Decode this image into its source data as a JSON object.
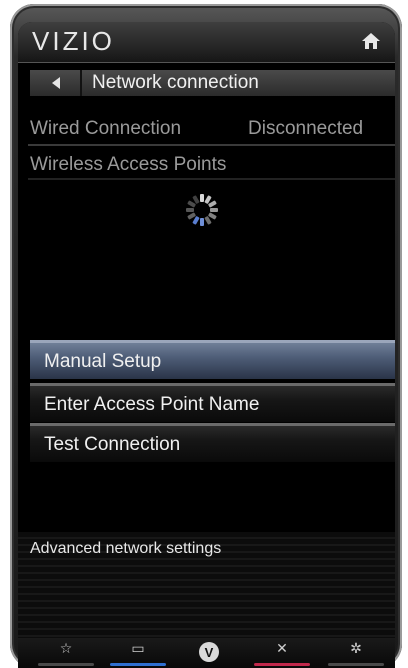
{
  "brand": "VIZIO",
  "header": {
    "title": "Network connection"
  },
  "wired": {
    "label": "Wired Connection",
    "status": "Disconnected"
  },
  "wireless": {
    "label": "Wireless Access Points"
  },
  "menu": {
    "items": [
      {
        "label": "Manual Setup",
        "selected": true
      },
      {
        "label": "Enter Access Point Name",
        "selected": false
      },
      {
        "label": "Test Connection",
        "selected": false
      }
    ]
  },
  "advanced": {
    "label": "Advanced network settings"
  },
  "bottom": {
    "buttons": [
      {
        "icon": "star-icon",
        "glyph": "☆",
        "color": "#4a4a4a"
      },
      {
        "icon": "screen-icon",
        "glyph": "▭",
        "color": "#2f6fd0"
      },
      {
        "icon": "vizio-v-icon",
        "glyph": "V",
        "color": "#000000"
      },
      {
        "icon": "close-icon",
        "glyph": "✕",
        "color": "#c0284b"
      },
      {
        "icon": "gear-icon",
        "glyph": "✲",
        "color": "#4a4a4a"
      }
    ]
  },
  "colors": {
    "selected": "#5a6a86",
    "accent_red": "#c0284b",
    "accent_blue": "#2f6fd0"
  }
}
